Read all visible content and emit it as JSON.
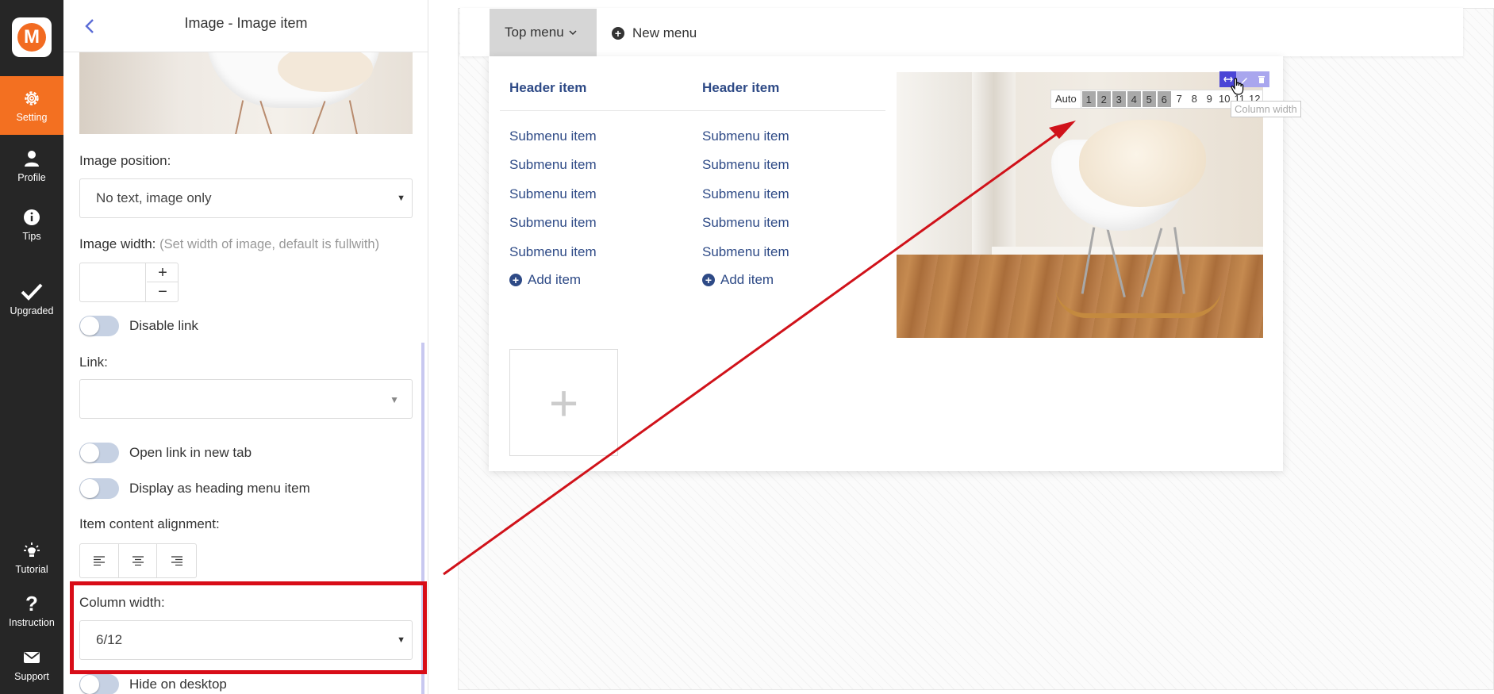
{
  "sidebar_nav": {
    "logo_letter": "M",
    "items": [
      {
        "label": "Setting",
        "icon": "gear-icon"
      },
      {
        "label": "Profile",
        "icon": "user-icon"
      },
      {
        "label": "Tips",
        "icon": "info-icon"
      },
      {
        "label": "Upgraded",
        "icon": "check-icon"
      },
      {
        "label": "Tutorial",
        "icon": "lightbulb-icon"
      },
      {
        "label": "Instruction",
        "icon": "question-icon"
      },
      {
        "label": "Support",
        "icon": "mail-icon"
      }
    ],
    "active": "Setting",
    "active_color": "#f37021"
  },
  "panel": {
    "title": "Image - Image item",
    "image_position": {
      "label": "Image position:",
      "value": "No text, image only"
    },
    "image_width": {
      "label": "Image width:",
      "hint": "(Set width of image, default is fullwith)",
      "value": "",
      "plus": "+",
      "minus": "−"
    },
    "disable_link": {
      "label": "Disable link",
      "on": false
    },
    "link": {
      "label": "Link:",
      "value": ""
    },
    "open_new_tab": {
      "label": "Open link in new tab",
      "on": false
    },
    "display_heading": {
      "label": "Display as heading menu item",
      "on": false
    },
    "alignment": {
      "label": "Item content alignment:",
      "options": [
        "left",
        "center",
        "right"
      ]
    },
    "column_width": {
      "label": "Column width:",
      "value": "6/12"
    },
    "hide_desktop": {
      "label": "Hide on desktop",
      "on": false
    }
  },
  "preview": {
    "top_menu": "Top menu",
    "new_menu": "New menu",
    "columns": [
      {
        "header": "Header item",
        "items": [
          "Submenu item",
          "Submenu item",
          "Submenu item",
          "Submenu item",
          "Submenu item"
        ],
        "add": "Add item"
      },
      {
        "header": "Header item",
        "items": [
          "Submenu item",
          "Submenu item",
          "Submenu item",
          "Submenu item",
          "Submenu item"
        ],
        "add": "Add item"
      }
    ],
    "add_column": "+",
    "column_toolbar": {
      "auto": "Auto",
      "numbers": [
        "1",
        "2",
        "3",
        "4",
        "5",
        "6",
        "7",
        "8",
        "9",
        "10",
        "11",
        "12"
      ],
      "selected_upto": 6,
      "tooltip": "Column width",
      "icons": [
        "column-width-icon",
        "edit-icon",
        "delete-icon"
      ]
    }
  },
  "colors": {
    "link": "#2e4a86",
    "highlight": "#d80d18",
    "toolbar_active": "#4b45d6"
  }
}
